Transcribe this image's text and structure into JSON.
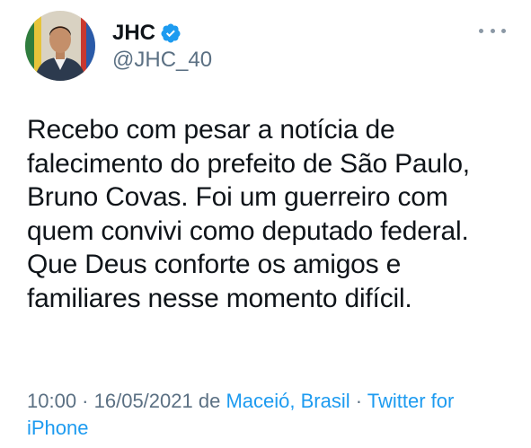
{
  "author": {
    "display_name": "JHC",
    "handle": "@JHC_40",
    "verified": true,
    "avatar_icon": "profile-photo",
    "verified_icon": "verified-badge-icon"
  },
  "actions": {
    "more_icon": "more-options-icon"
  },
  "tweet": {
    "text": "Recebo com pesar a notícia de\nfalecimento do prefeito de São Paulo,\nBruno Covas. Foi um guerreiro com\nquem convivi como deputado federal.\nQue Deus conforte os amigos e\nfamiliares nesse momento difícil."
  },
  "meta": {
    "time": "10:00",
    "separator1": " · ",
    "date": "16/05/2021",
    "location_prefix": " de ",
    "location": "Maceió, Brasil",
    "separator2": " · ",
    "source": "Twitter for iPhone"
  },
  "colors": {
    "text_primary": "#0f1419",
    "text_secondary": "#5b7083",
    "link": "#1d9bf0",
    "verified": "#1d9bf0",
    "background": "#ffffff"
  }
}
